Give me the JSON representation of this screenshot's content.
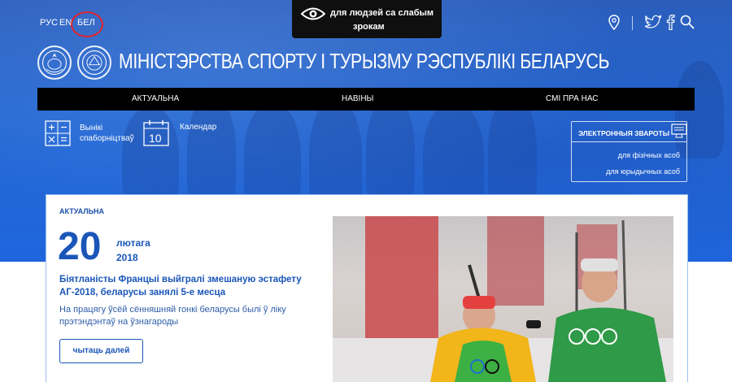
{
  "languages": [
    {
      "label": "РУС",
      "active": false
    },
    {
      "label": "EN",
      "active": false
    },
    {
      "label": "БЕЛ",
      "active": true
    }
  ],
  "low_vision": {
    "line1": "для людзей са слабым",
    "line2": "зрокам",
    "icon": "eye-icon"
  },
  "top_icons": [
    "location-pin-icon",
    "twitter-icon",
    "facebook-icon",
    "search-icon"
  ],
  "site_title": "МІНІСТЭРСТВА СПОРТУ І ТУРЫЗМУ РЭСПУБЛІКІ БЕЛАРУСЬ",
  "main_nav": [
    "АКТУАЛЬНА",
    "НАВІНЫ",
    "СМІ ПРА НАС"
  ],
  "quick_links": {
    "results": {
      "line1": "Вынікі",
      "line2": "спаборніцтваў",
      "icon": "calculator-icon"
    },
    "calendar": {
      "label": "Календар",
      "day": "10",
      "icon": "calendar-icon"
    }
  },
  "e_services": {
    "title": "ЭЛЕКТРОННЫЯ ЗВАРОТЫ",
    "links": [
      "для фізічных асоб",
      "для юрыдычных асоб"
    ],
    "icon": "monitor-icon"
  },
  "news": {
    "section_label": "АКТУАЛЬНА",
    "day": "20",
    "month": "лютага",
    "year": "2018",
    "headline": "Біятланісты Францыі выйгралі змешаную эстафету АГ-2018, беларусы занялі 5-е месца",
    "lead": "На працягу ўсёй сённяшняй гонкі беларусы былі ў ліку прэтэндэнтаў на ўзнагароды",
    "read_more": "чытаць далей",
    "image_icon": "biathlon-photo"
  },
  "colors": {
    "accent": "#1a56b8",
    "nav_bg": "#000000",
    "hero": "#2a6fd6",
    "highlight": "#e0242e"
  }
}
